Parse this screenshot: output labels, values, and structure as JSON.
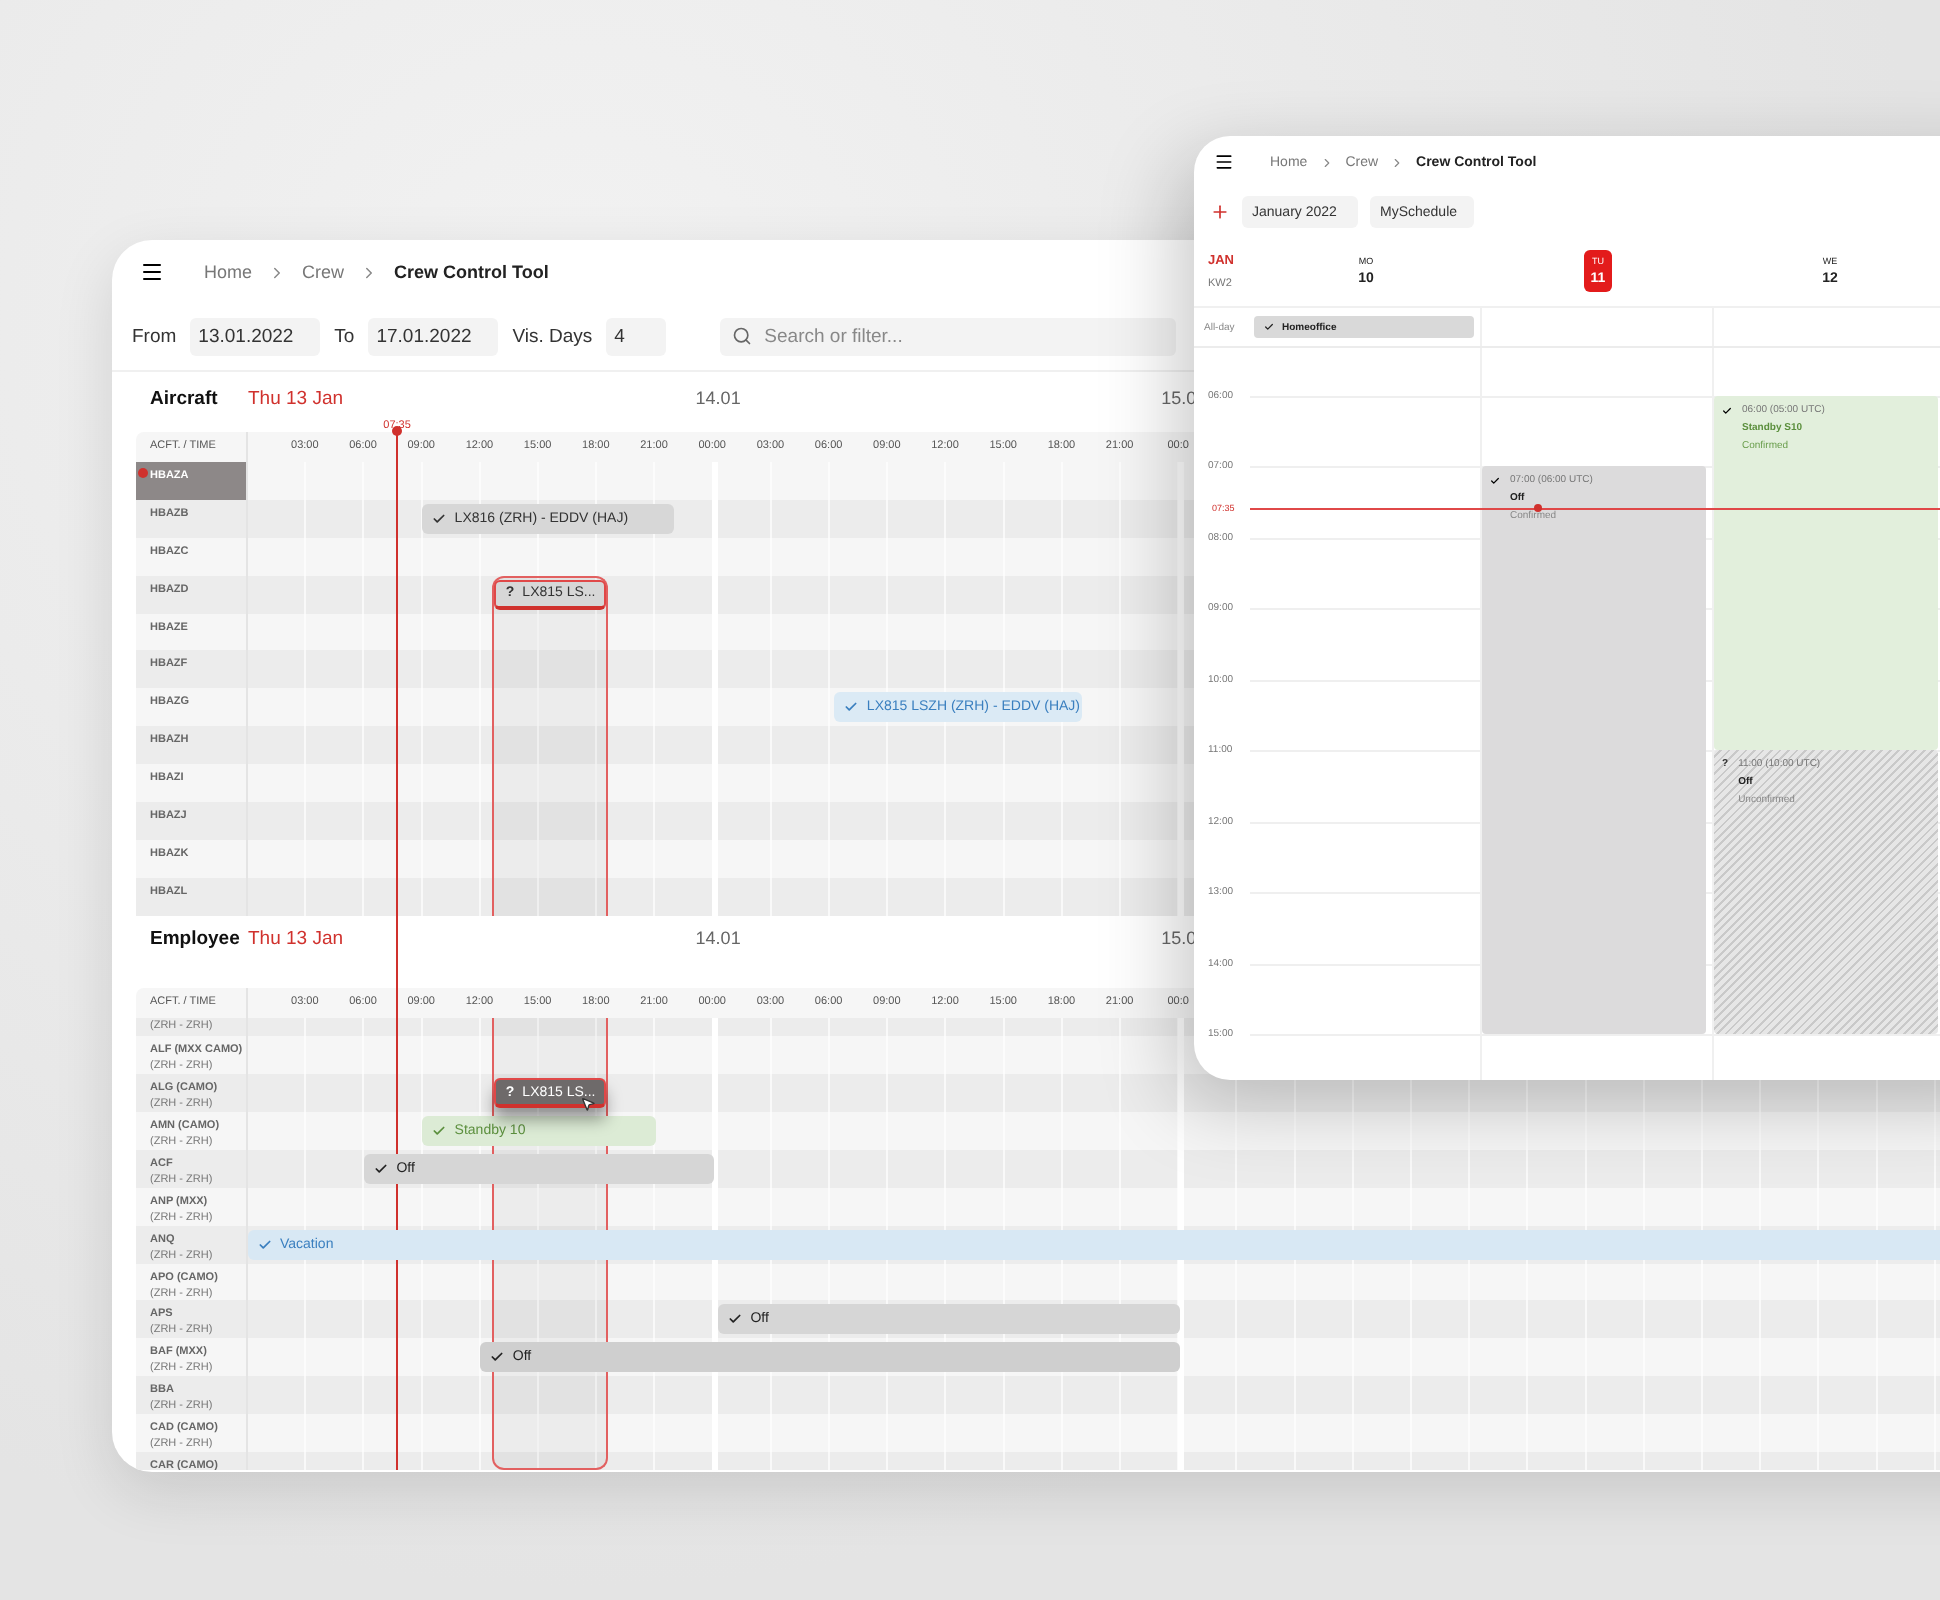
{
  "back_window": {
    "breadcrumb": [
      "Home",
      "Crew",
      "Crew Control Tool"
    ],
    "filters": {
      "from_label": "From",
      "from": "13.01.2022",
      "to_label": "To",
      "to": "17.01.2022",
      "days_label": "Vis. Days",
      "days": "4",
      "search_placeholder": "Search or filter..."
    },
    "now": "07:35",
    "sections": [
      {
        "title": "Aircraft",
        "date": "Thu 13 Jan",
        "day_labels": [
          "14.01",
          "15.0"
        ],
        "column_header": "ACFT. / TIME",
        "time_ticks": [
          "03:00",
          "06:00",
          "09:00",
          "12:00",
          "15:00",
          "18:00",
          "21:00",
          "00:00",
          "03:00",
          "06:00",
          "09:00",
          "12:00",
          "15:00",
          "18:00",
          "21:00",
          "00:0"
        ],
        "rows": [
          {
            "name": "HBAZA",
            "selected": true
          },
          {
            "name": "HBAZB",
            "selected": false,
            "events": [
              {
                "kind": "flight",
                "label": "LX816 (ZRH) - EDDV (HAJ)",
                "confirmed": true,
                "selected": false
              }
            ]
          },
          {
            "name": "HBAZC",
            "selected": false
          },
          {
            "name": "HBAZD",
            "selected": false,
            "events": [
              {
                "kind": "flight",
                "label": "LX815 LS...",
                "confirmed": false,
                "mark": "?",
                "selected": true
              }
            ]
          },
          {
            "name": "HBAZE",
            "selected": false
          },
          {
            "name": "HBAZF",
            "selected": false
          },
          {
            "name": "HBAZG",
            "selected": false,
            "events": [
              {
                "kind": "flight_confirmed",
                "label": "LX815 LSZH (ZRH) - EDDV (HAJ)",
                "confirmed": true,
                "selected": false
              }
            ]
          },
          {
            "name": "HBAZH",
            "selected": false
          },
          {
            "name": "HBAZI",
            "selected": false
          },
          {
            "name": "HBAZJ",
            "selected": false
          },
          {
            "name": "HBAZK",
            "selected": false
          },
          {
            "name": "HBAZL",
            "selected": false
          }
        ]
      },
      {
        "title": "Employee",
        "date": "Thu 13 Jan",
        "day_labels": [
          "14.01",
          "15.0"
        ],
        "column_header": "ACFT. / TIME",
        "time_ticks": [
          "03:00",
          "06:00",
          "09:00",
          "12:00",
          "15:00",
          "18:00",
          "21:00",
          "00:00",
          "03:00",
          "06:00",
          "09:00",
          "12:00",
          "15:00",
          "18:00",
          "21:00",
          "00:0"
        ],
        "rows": [
          {
            "route": "(ZRH - ZRH)"
          },
          {
            "name": "ALF (MXX CAMO)",
            "route": "(ZRH - ZRH)"
          },
          {
            "name": "ALG (CAMO)",
            "route": "(ZRH - ZRH)",
            "events": [
              {
                "kind": "drag",
                "label": "LX815 LS...",
                "confirmed": false,
                "mark": "?",
                "selected": true
              }
            ]
          },
          {
            "name": "AMN (CAMO)",
            "route": "(ZRH - ZRH)",
            "events": [
              {
                "kind": "standby",
                "label": "Standby 10",
                "confirmed": true,
                "selected": false
              }
            ]
          },
          {
            "name": "ACF",
            "route": "(ZRH - ZRH)",
            "events": [
              {
                "kind": "off",
                "label": "Off",
                "confirmed": true,
                "selected": false
              }
            ]
          },
          {
            "name": "ANP (MXX)",
            "route": "(ZRH - ZRH)"
          },
          {
            "name": "ANQ",
            "route": "(ZRH - ZRH)",
            "events": [
              {
                "kind": "vacation",
                "label": "Vacation",
                "confirmed": true,
                "selected": false
              }
            ]
          },
          {
            "name": "APO (CAMO)",
            "route": "(ZRH - ZRH)"
          },
          {
            "name": "APS",
            "route": "(ZRH - ZRH)",
            "events": [
              {
                "kind": "off",
                "label": "Off",
                "confirmed": true,
                "selected": false
              }
            ]
          },
          {
            "name": "BAF (MXX)",
            "route": "(ZRH - ZRH)",
            "events": [
              {
                "kind": "off_dark",
                "label": "Off",
                "confirmed": true,
                "selected": false
              }
            ]
          },
          {
            "name": "BBA",
            "route": "(ZRH - ZRH)"
          },
          {
            "name": "CAD (CAMO)",
            "route": "(ZRH - ZRH)"
          },
          {
            "name": "CAR (CAMO)"
          }
        ]
      }
    ]
  },
  "front_window": {
    "breadcrumb": [
      "Home",
      "Crew",
      "Crew Control Tool"
    ],
    "month": "January 2022",
    "view": "MySchedule",
    "month_short": "JAN",
    "week": "KW2",
    "all_day_label": "All-day",
    "now": "07:35",
    "hours": [
      "06:00",
      "07:00",
      "08:00",
      "09:00",
      "10:00",
      "11:00",
      "12:00",
      "13:00",
      "14:00",
      "15:00"
    ],
    "days": [
      {
        "weekday": "MO",
        "date": "10",
        "selected": false,
        "all_day": [
          {
            "label": "Homeoffice",
            "confirmed": true
          }
        ]
      },
      {
        "weekday": "TU",
        "date": "11",
        "selected": true,
        "events": [
          {
            "kind": "off",
            "time": "07:00 (06:00 UTC)",
            "title": "Off",
            "status": "Confirmed",
            "confirmed": true
          }
        ]
      },
      {
        "weekday": "WE",
        "date": "12",
        "selected": false,
        "events": [
          {
            "kind": "standby",
            "time": "06:00 (05:00 UTC)",
            "title": "Standby S10",
            "status": "Confirmed",
            "confirmed": true
          },
          {
            "kind": "unconfirmed",
            "time": "11:00 (10:00 UTC)",
            "title": "Off",
            "status": "Unconfirmed",
            "confirmed": false,
            "mark": "?"
          }
        ]
      }
    ]
  }
}
